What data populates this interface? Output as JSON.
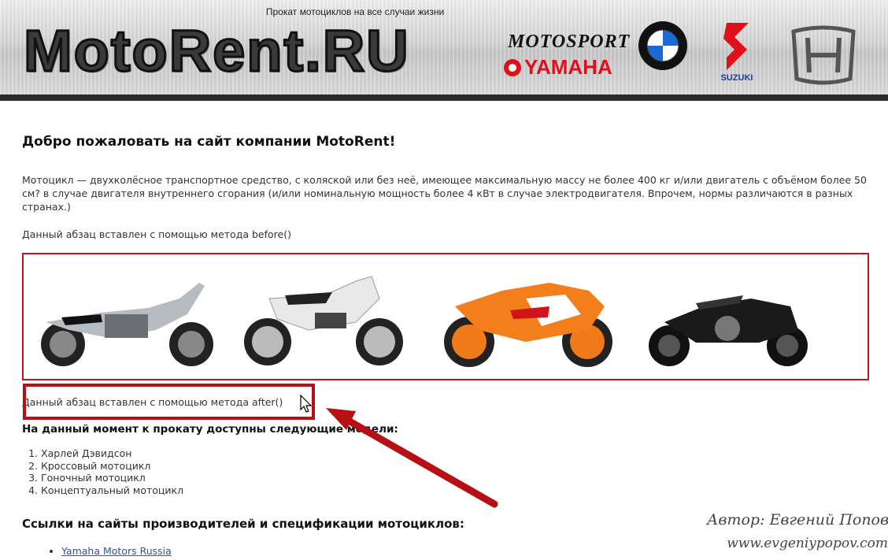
{
  "header": {
    "tagline": "Прокат мотоциклов на все случаи жизни",
    "logo_text": "MotoRent.RU",
    "brands": {
      "motosport": "MOTOSPORT",
      "yamaha": "YAMAHA",
      "suzuki": "SUZUKI"
    }
  },
  "main": {
    "welcome_heading": "Добро пожаловать на сайт компании MotoRent!",
    "intro_paragraph": "Мотоцикл — двухколёсное транспортное средство, с коляской или без неё, имеющее максимальную массу не более 400 кг и/или двигатель с объёмом более 50 см? в случае двигателя внутреннего сгорания (и/или номинальную мощность более 4 кВт в случае электродвигателя. Впрочем, нормы различаются в разных странах.)",
    "before_paragraph": "Данный абзац вставлен с помощью метода before()",
    "after_paragraph": "Данный абзац вставлен с помощью метода after()",
    "models_heading": "На данный момент к прокату доступны следующие модели:",
    "models": [
      "Харлей Дэвидсон",
      "Кроссовый мотоцикл",
      "Гоночный мотоцикл",
      "Концептуальный мотоцикл"
    ],
    "links_heading": "Ссылки на сайты производителей и спецификации мотоциклов:",
    "links": [
      "Yamaha Motors Russia"
    ]
  },
  "watermark": {
    "author_line": "Автор: Евгений Попов",
    "site_line": "www.evgeniypopov.com"
  },
  "colors": {
    "highlight_red": "#b80f15",
    "header_bar": "#2a2a2a",
    "link_blue": "#2255bb"
  }
}
